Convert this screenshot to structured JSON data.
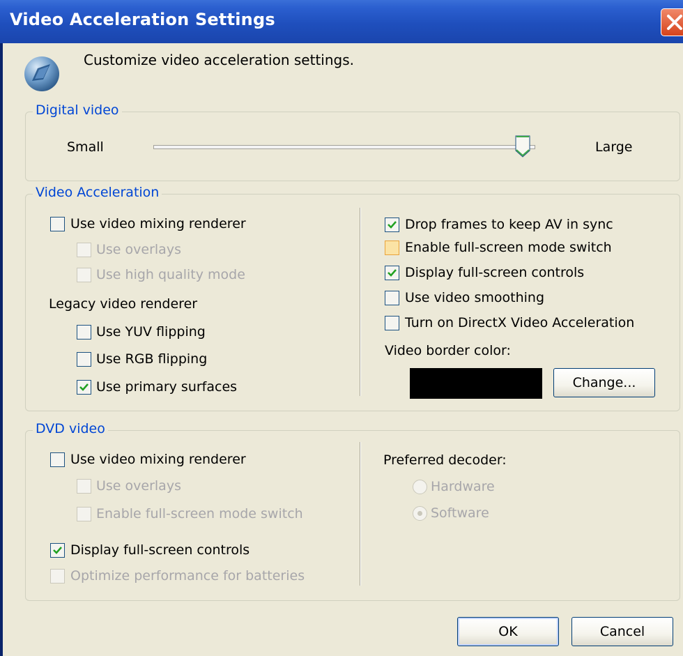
{
  "window": {
    "title": "Video Acceleration Settings",
    "intro": "Customize video acceleration settings."
  },
  "digital_video": {
    "group_title": "Digital video",
    "slider_min_label": "Small",
    "slider_max_label": "Large",
    "slider_value_fraction": 0.97
  },
  "video_acceleration": {
    "group_title": "Video Acceleration",
    "use_vmr": {
      "label": "Use video mixing renderer",
      "checked": false
    },
    "use_overlays": {
      "label": "Use overlays",
      "checked": false,
      "disabled": true
    },
    "use_hq_mode": {
      "label": "Use high quality mode",
      "checked": false,
      "disabled": true
    },
    "legacy_heading": "Legacy video renderer",
    "yuv_flipping": {
      "label": "Use YUV flipping",
      "checked": false
    },
    "rgb_flipping": {
      "label": "Use RGB flipping",
      "checked": false
    },
    "primary_surfaces": {
      "label": "Use primary surfaces",
      "checked": true
    },
    "drop_frames": {
      "label": "Drop frames to keep AV in sync",
      "checked": true
    },
    "fullscreen_switch": {
      "label": "Enable full-screen mode switch",
      "checked": false
    },
    "fullscreen_controls": {
      "label": "Display full-screen controls",
      "checked": true
    },
    "video_smoothing": {
      "label": "Use video smoothing",
      "checked": false
    },
    "directx_accel": {
      "label": "Turn on DirectX Video Acceleration",
      "checked": false
    },
    "border_color_label": "Video border color:",
    "border_color": "#000000",
    "change_button": "Change..."
  },
  "dvd_video": {
    "group_title": "DVD video",
    "use_vmr": {
      "label": "Use video mixing renderer",
      "checked": false
    },
    "use_overlays": {
      "label": "Use overlays",
      "checked": false,
      "disabled": true
    },
    "fullscreen_switch": {
      "label": "Enable full-screen mode switch",
      "checked": false,
      "disabled": true
    },
    "fullscreen_controls": {
      "label": "Display full-screen controls",
      "checked": true
    },
    "optimize_batteries": {
      "label": "Optimize performance for batteries",
      "checked": false,
      "disabled": true
    },
    "decoder_heading": "Preferred decoder:",
    "hardware": {
      "label": "Hardware",
      "selected": false,
      "disabled": true
    },
    "software": {
      "label": "Software",
      "selected": true,
      "disabled": true
    }
  },
  "buttons": {
    "ok": "OK",
    "cancel": "Cancel"
  },
  "colors": {
    "titlebar": "#2b5fcf",
    "dialog_bg": "#ece9d8",
    "group_title": "#0046d5",
    "close_button": "#d6431b"
  }
}
